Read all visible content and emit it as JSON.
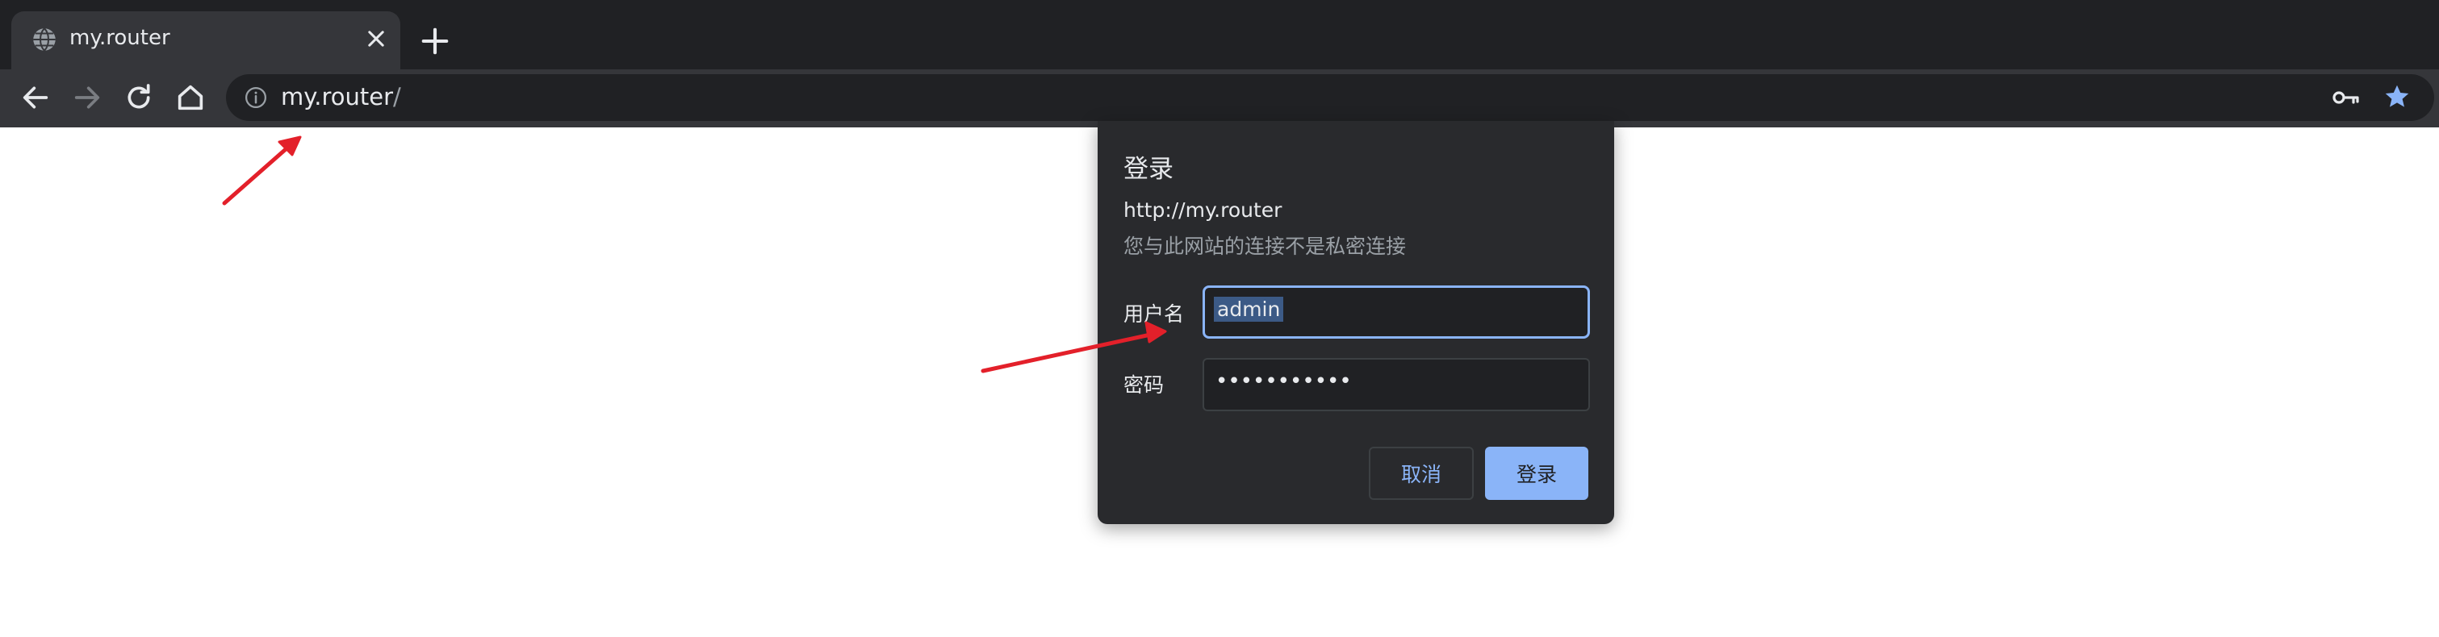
{
  "tab": {
    "title": "my.router",
    "icon": "globe-icon"
  },
  "toolbar": {
    "url_host": "my.router",
    "url_path": "/",
    "icons": [
      "back-icon",
      "forward-icon",
      "reload-icon",
      "home-icon",
      "info-icon",
      "key-icon",
      "star-icon"
    ]
  },
  "dialog": {
    "title": "登录",
    "url": "http://my.router",
    "warning": "您与此网站的连接不是私密连接",
    "username_label": "用户名",
    "username_value": "admin",
    "password_label": "密码",
    "password_mask": "•••••••••••",
    "cancel_label": "取消",
    "login_label": "登录"
  },
  "colors": {
    "tabstrip": "#202124",
    "toolbar": "#35363a",
    "dialog": "#292a2d",
    "accent": "#8ab4f8",
    "annotation_arrow": "#e3202a"
  }
}
